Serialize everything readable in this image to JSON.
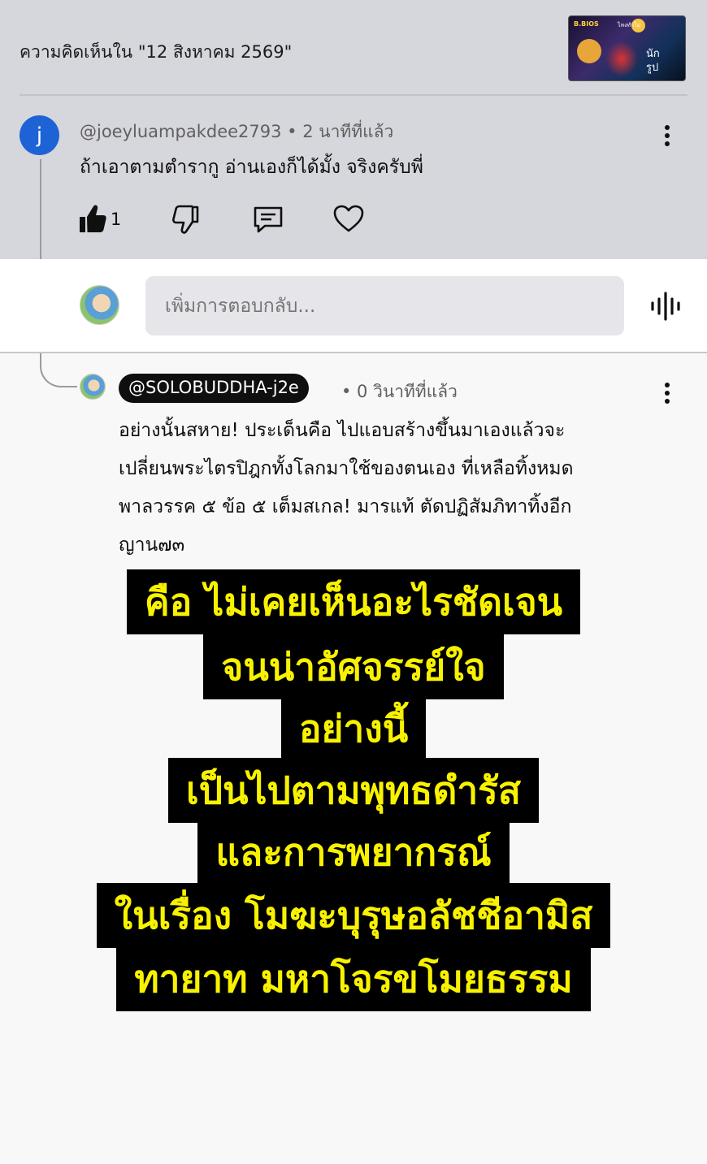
{
  "header": {
    "title": "ความคิดเห็นใน \"12 สิงหาคม 2569\"",
    "thumbnail": {
      "text_a": "B.BIOS",
      "text_b": "ไหงทำไม่",
      "text_c": "นัก\nรูป"
    }
  },
  "comment1": {
    "avatar_letter": "j",
    "author": "@joeyluampakdee2793",
    "time": "• 2 นาทีที่แล้ว",
    "text": "ถ้าเอาตามตำรากู อ่านเองก็ได้มั้ง จริงครับพี่",
    "like_count": "1"
  },
  "reply_box": {
    "placeholder": "เพิ่มการตอบกลับ..."
  },
  "comment2": {
    "author": "@SOLOBUDDHA-j2e",
    "time": "• 0 วินาทีที่แล้ว",
    "text_lines": [
      "อย่างนั้นสหาย!  ประเด็นคือ ไปแอบสร้างขึ้นมาเองแล้วจะ",
      "เปลี่ยนพระไตรปิฎกทั้งโลกมาใช้ของตนเอง ที่เหลือทิ้งหมด",
      "พาลวรรค ๕  ข้อ ๕ เต็มสเกล! มารแท้ ตัดปฏิสัมภิทาทิ้งอีก",
      "ญาน๗๓"
    ]
  },
  "overlay_lines": [
    "คือ ไม่เคยเห็นอะไรชัดเจน",
    "จนน่าอัศจรรย์ใจ",
    "อย่างนี้",
    "เป็นไปตามพุทธดำรัส",
    "และการพยากรณ์",
    "ในเรื่อง โมฆะบุรุษอลัชชีอามิส",
    "ทายาท มหาโจรขโมยธรรม"
  ],
  "icons": {
    "like": "thumbs-up-filled",
    "dislike": "thumbs-down-outline",
    "reply": "comment-outline",
    "heart": "heart-outline",
    "more": "vertical-ellipsis",
    "voice": "voice-waveform"
  },
  "colors": {
    "top_background": "#d6d6dd",
    "avatar_blue": "#1e63d6",
    "overlay_text": "#f8f200",
    "overlay_bg": "#000000"
  }
}
